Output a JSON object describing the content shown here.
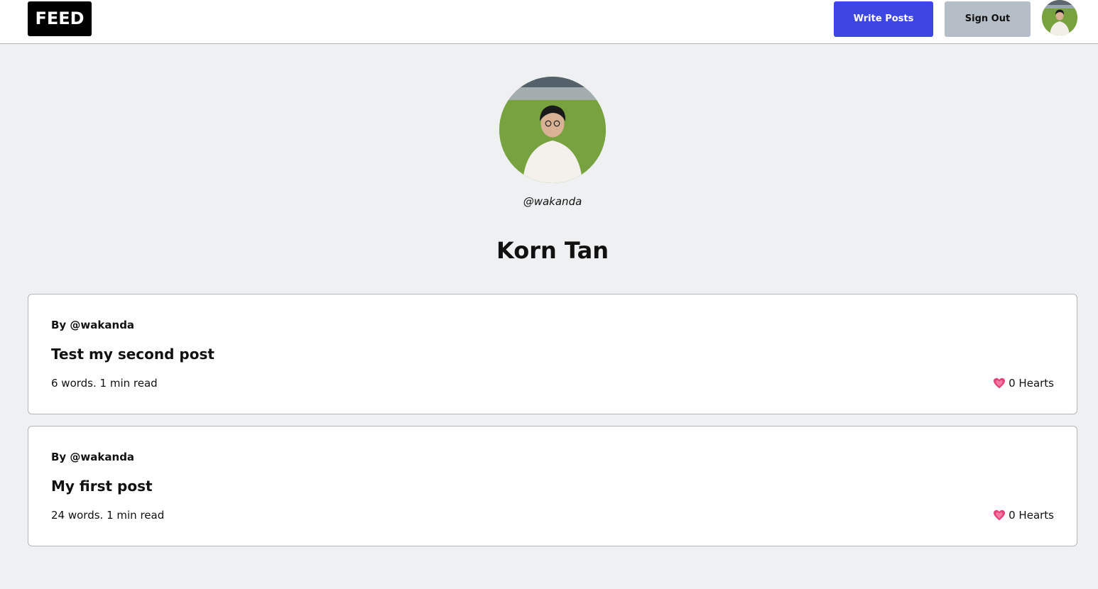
{
  "navbar": {
    "logo": "FEED",
    "write_posts": "Write Posts",
    "sign_out": "Sign Out"
  },
  "profile": {
    "handle": "@wakanda",
    "name": "Korn Tan"
  },
  "posts": [
    {
      "author": "By @wakanda",
      "title": "Test my second post",
      "meta": "6 words. 1 min read",
      "hearts": "0 Hearts"
    },
    {
      "author": "By @wakanda",
      "title": "My first post",
      "meta": "24 words. 1 min read",
      "hearts": "0 Hearts"
    }
  ],
  "colors": {
    "accent": "#3d46e2",
    "secondary_button": "#b5bdc6",
    "background": "#eef0f2",
    "heart": "#e5437a"
  },
  "icons": {
    "heart": "heart-icon",
    "avatar": "user-avatar"
  }
}
